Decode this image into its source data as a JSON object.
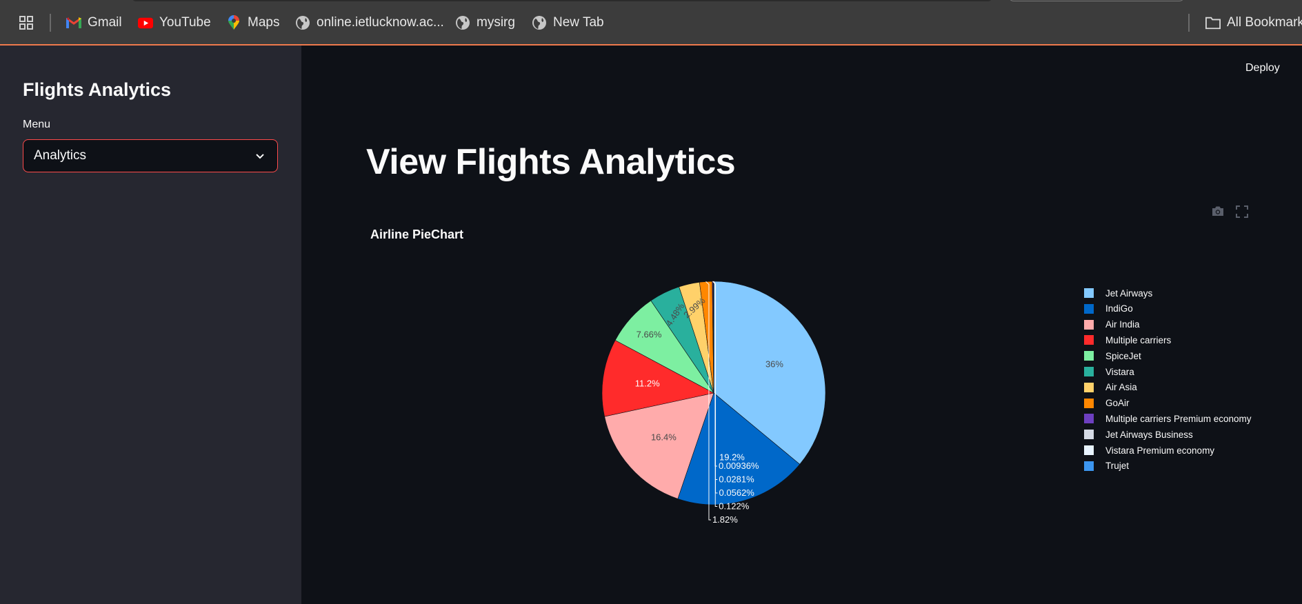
{
  "bookmarks": [
    {
      "label": "",
      "icon": "apps-grid-icon"
    },
    {
      "label": "Gmail",
      "icon": "gmail-icon"
    },
    {
      "label": "YouTube",
      "icon": "youtube-icon"
    },
    {
      "label": "Maps",
      "icon": "maps-pin-icon"
    },
    {
      "label": "online.ietlucknow.ac...",
      "icon": "globe-icon"
    },
    {
      "label": "mysirg",
      "icon": "globe-icon"
    },
    {
      "label": "New Tab",
      "icon": "globe-icon"
    }
  ],
  "all_bookmarks": "All Bookmarks",
  "sidebar": {
    "title": "Flights Analytics",
    "menu_label": "Menu",
    "menu_value": "Analytics"
  },
  "header": {
    "deploy": "Deploy"
  },
  "main": {
    "title": "View Flights Analytics",
    "chart_title": "Airline PieChart"
  },
  "colors": {
    "app_bg": "#0e1117",
    "sidebar_bg": "#262730",
    "accent": "#ff4b4b"
  },
  "chart_data": {
    "type": "pie",
    "title": "Airline PieChart",
    "legend_position": "right",
    "labels": [
      "Jet Airways",
      "IndiGo",
      "Air India",
      "Multiple carriers",
      "SpiceJet",
      "Vistara",
      "Air Asia",
      "GoAir",
      "Multiple carriers Premium economy",
      "Jet Airways Business",
      "Vistara Premium economy",
      "Trujet"
    ],
    "values": [
      36,
      19.2,
      16.4,
      11.2,
      7.66,
      4.48,
      2.99,
      1.82,
      0.122,
      0.0562,
      0.0281,
      0.00936
    ],
    "value_labels": [
      "36%",
      "19.2%",
      "16.4%",
      "11.2%",
      "7.66%",
      "4.48%",
      "2.99%",
      "1.82%",
      "0.122%",
      "0.0562%",
      "0.0281%",
      "0.00936%"
    ],
    "colors": [
      "#83c9ff",
      "#0068c9",
      "#ffabab",
      "#ff2b2b",
      "#7defa1",
      "#29b09d",
      "#ffd16a",
      "#ff8700",
      "#6d3fc0",
      "#d5dae5",
      "#e8f4ff",
      "#3c96f0"
    ]
  }
}
